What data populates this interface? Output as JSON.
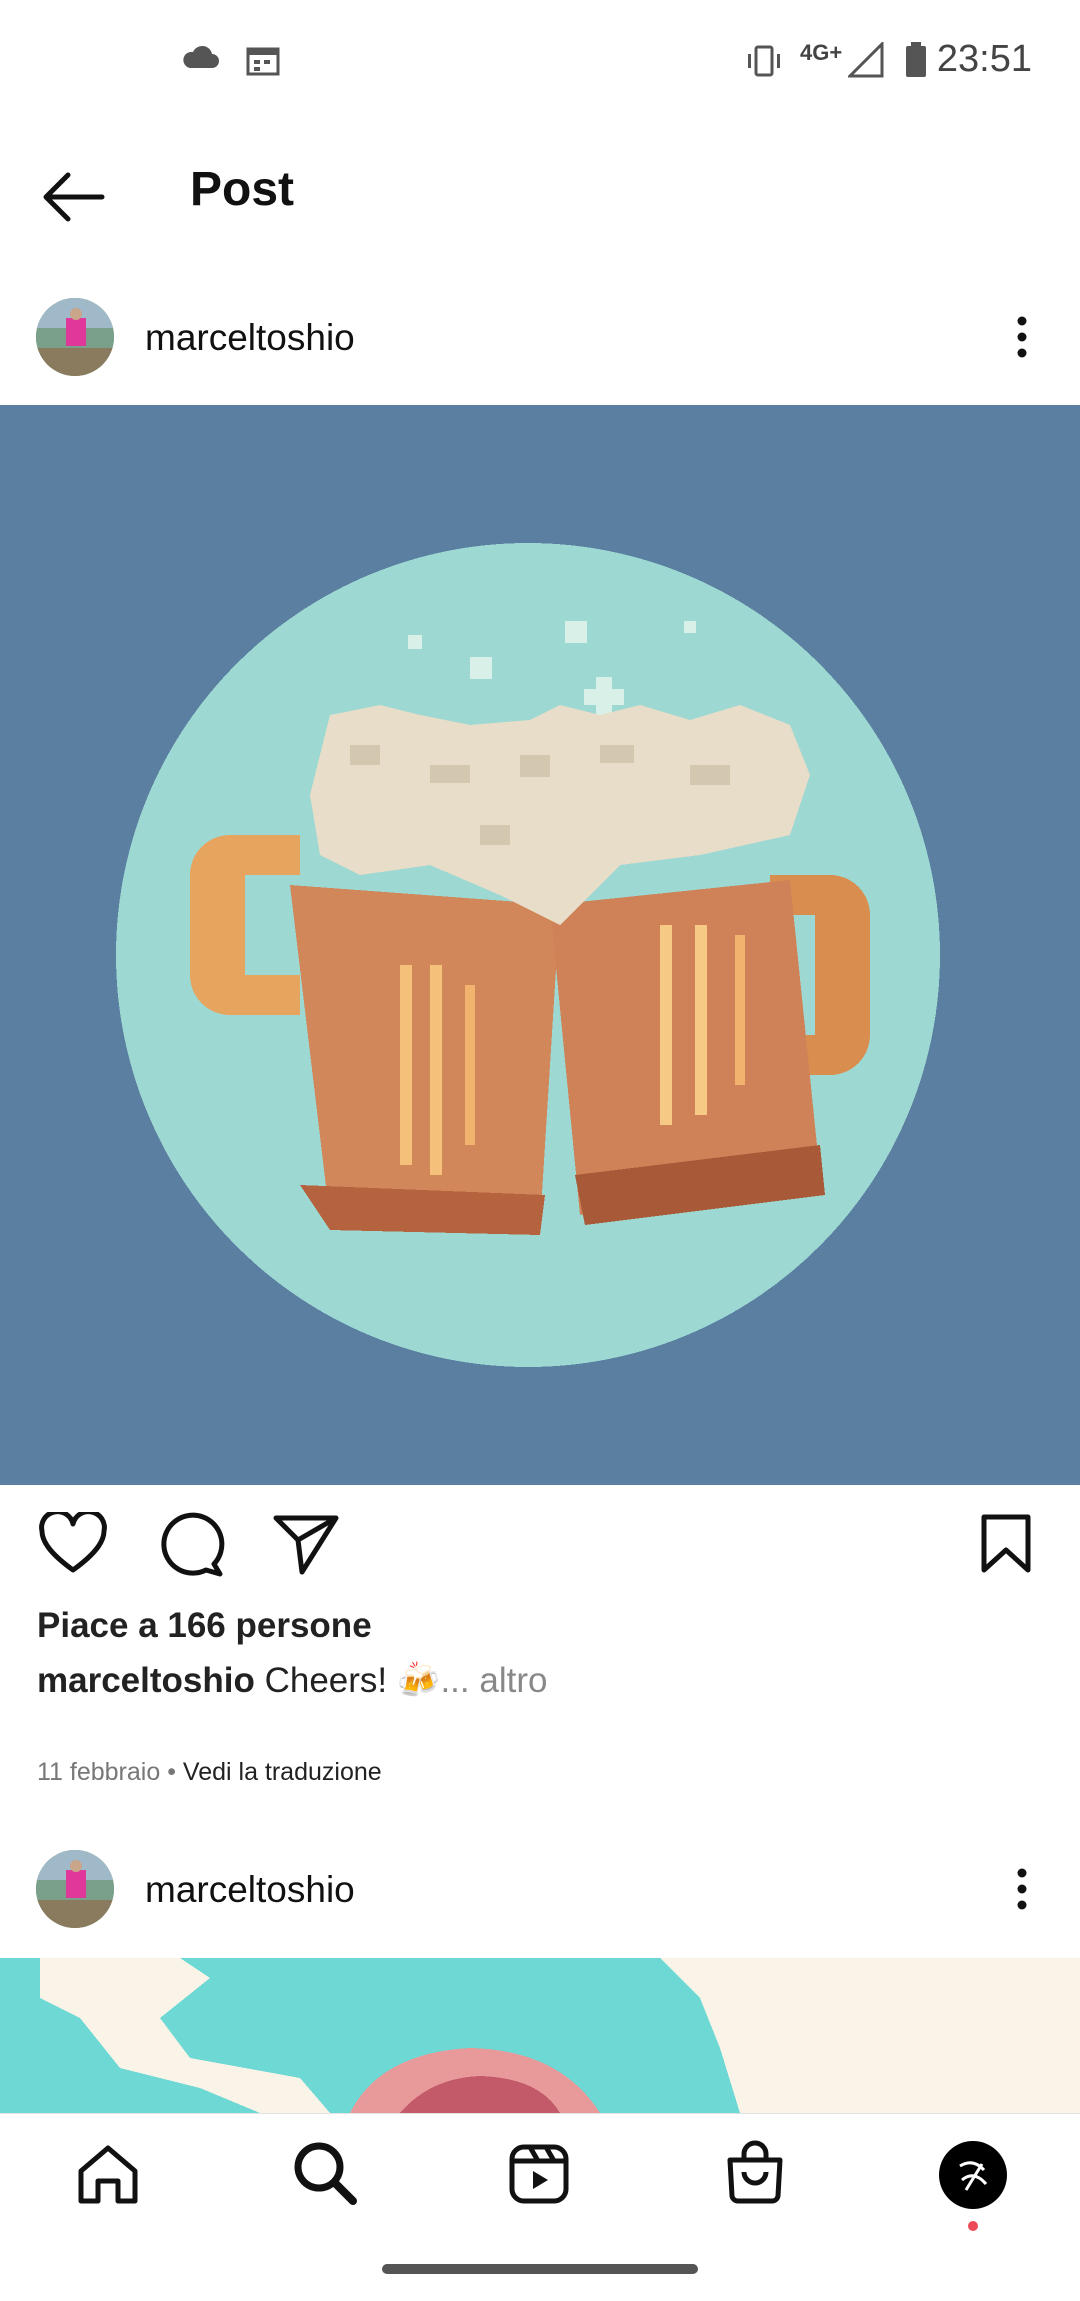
{
  "status_bar": {
    "time": "23:51",
    "network": "4G+"
  },
  "header": {
    "title": "Post"
  },
  "posts": [
    {
      "username": "marceltoshio",
      "likes_text": "Piace a 166 persone",
      "caption_user": "marceltoshio",
      "caption_text": "Cheers! 🍻",
      "caption_more": "... altro",
      "date": "11 febbraio",
      "separator": " • ",
      "translate_link": "Vedi la traduzione"
    },
    {
      "username": "marceltoshio"
    }
  ],
  "icons": {
    "back": "arrow-left-icon",
    "like": "heart-icon",
    "comment": "comment-icon",
    "share": "send-icon",
    "save": "bookmark-icon",
    "nav": [
      "home-icon",
      "search-icon",
      "reels-icon",
      "shop-icon",
      "profile-avatar"
    ]
  },
  "colors": {
    "image_bg": "#5a7fa0",
    "circle": "#9ed8d2",
    "foam": "#e8ddc8",
    "beer": "#d2875a",
    "notification_dot": "#ed4956"
  }
}
